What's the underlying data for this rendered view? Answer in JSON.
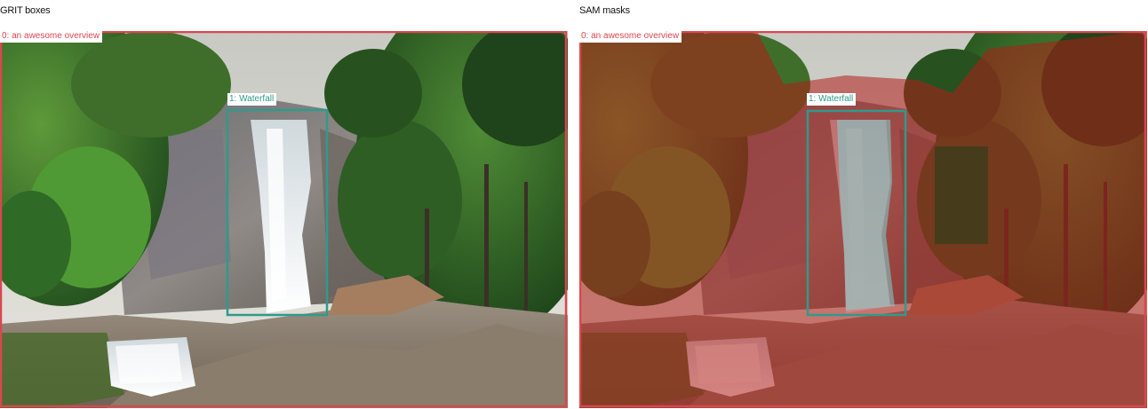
{
  "panels": {
    "left": {
      "title": "GRIT boxes"
    },
    "right": {
      "title": "SAM masks"
    }
  },
  "detections": [
    {
      "label": "0: an awesome overview",
      "color": "#d9474f"
    },
    {
      "label": "1: Waterfall",
      "color": "#2f9a8c"
    }
  ],
  "colors": {
    "mask_overlay": "#b01e18",
    "waterfall_mask": "#7fd6d6"
  }
}
